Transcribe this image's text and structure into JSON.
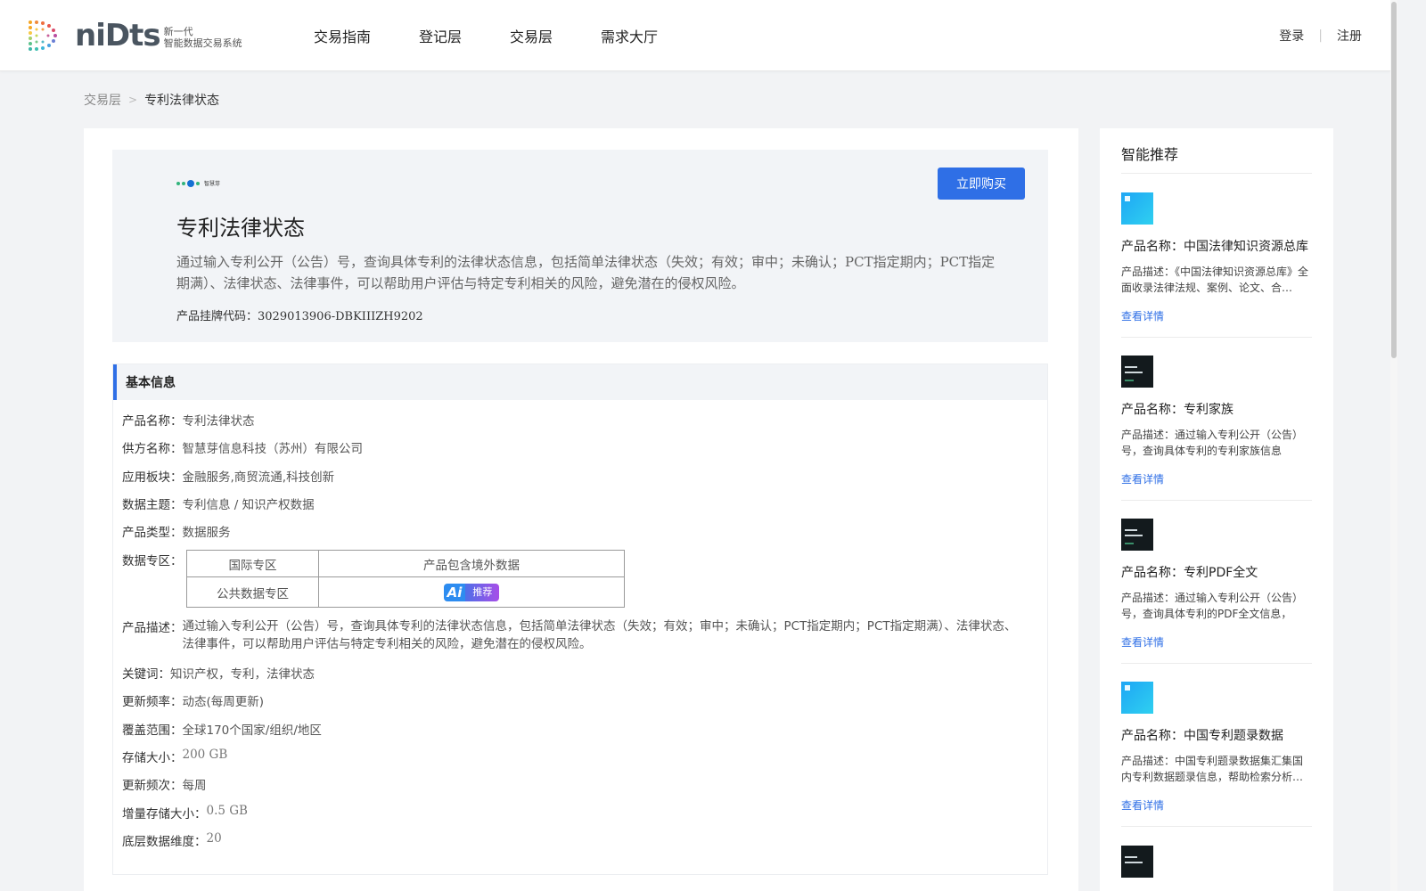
{
  "header": {
    "logo_word": "niDts",
    "logo_sub_line1": "新一代",
    "logo_sub_line2": "智能数据交易系统",
    "nav": [
      "交易指南",
      "登记层",
      "交易层",
      "需求大厅"
    ],
    "login": "登录",
    "register": "注册"
  },
  "breadcrumb": {
    "parent": "交易层",
    "current": "专利法律状态"
  },
  "product": {
    "logo_text": "智慧芽",
    "title": "专利法律状态",
    "description": "通过输入专利公开（公告）号，查询具体专利的法律状态信息，包括简单法律状态（失效；有效；审中；未确认；PCT指定期内；PCT指定期满）、法律状态、法律事件，可以帮助用户评估与特定专利相关的风险，避免潜在的侵权风险。",
    "code_label": "产品挂牌代码：",
    "code_value": "3029013906-DBKIIIZH9202",
    "buy_label": "立即购买"
  },
  "basic_info": {
    "heading": "基本信息",
    "product_name_label": "产品名称：",
    "product_name": "专利法律状态",
    "supplier_label": "供方名称：",
    "supplier": "智慧芽信息科技（苏州）有限公司",
    "sector_label": "应用板块：",
    "sector": "金融服务,商贸流通,科技创新",
    "theme_label": "数据主题：",
    "theme": "专利信息 / 知识产权数据",
    "type_label": "产品类型：",
    "type": "数据服务",
    "zone_label": "数据专区：",
    "zone_table": {
      "r1c1": "国际专区",
      "r1c2": "产品包含境外数据",
      "r2c1": "公共数据专区",
      "badge_ai": "Ai",
      "badge_text": "推荐"
    },
    "desc_label": "产品描述：",
    "desc": "通过输入专利公开（公告）号，查询具体专利的法律状态信息，包括简单法律状态（失效；有效；审中；未确认；PCT指定期内；PCT指定期满）、法律状态、法律事件，可以帮助用户评估与特定专利相关的风险，避免潜在的侵权风险。",
    "keywords_label": "关键词：",
    "keywords": "知识产权，专利，法律状态",
    "frequency_label": "更新频率：",
    "frequency": "动态(每周更新)",
    "coverage_label": "覆盖范围：",
    "coverage": "全球170个国家/组织/地区",
    "storage_label": "存储大小：",
    "storage": "200 GB",
    "update_times_label": "更新频次：",
    "update_times": "每周",
    "incremental_label": "增量存储大小：",
    "incremental": "0.5 GB",
    "dimension_label": "底层数据维度：",
    "dimension": "20"
  },
  "sidebar": {
    "title": "智能推荐",
    "link_label": "查看详情",
    "items": [
      {
        "name": "产品名称：中国法律知识资源总库",
        "desc": "产品描述：《中国法律知识资源总库》全面收录法律法规、案例、论文、合…",
        "thumb": "light"
      },
      {
        "name": "产品名称：专利家族",
        "desc": "产品描述：通过输入专利公开（公告）号，查询具体专利的专利家族信息",
        "thumb": "dark"
      },
      {
        "name": "产品名称：专利PDF全文",
        "desc": "产品描述：通过输入专利公开（公告）号，查询具体专利的PDF全文信息，PD…",
        "thumb": "dark"
      },
      {
        "name": "产品名称：中国专利题录数据",
        "desc": "产品描述：中国专利题录数据集汇集国内专利数据题录信息，帮助检索分析…",
        "thumb": "light"
      }
    ]
  }
}
